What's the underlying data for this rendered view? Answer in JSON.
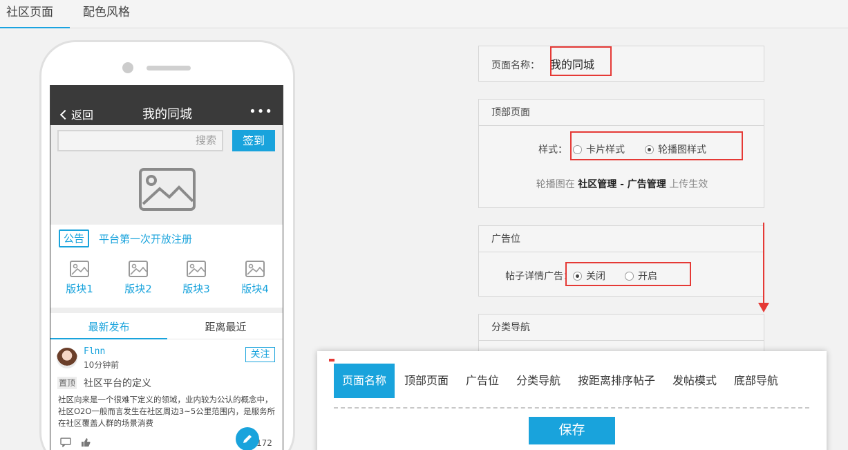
{
  "top_tabs": {
    "community_page": "社区页面",
    "color_style": "配色风格"
  },
  "phone": {
    "back_label": "返回",
    "title": "我的同城",
    "more": "•••",
    "search_placeholder": "搜索",
    "sign_in": "签到",
    "notice_tag": "公告",
    "notice_text": "平台第一次开放注册",
    "blocks": [
      "版块1",
      "版块2",
      "版块3",
      "版块4"
    ],
    "feed_tabs": [
      "最新发布",
      "距离最近"
    ],
    "post": {
      "user": "Flnn",
      "time": "10分钟前",
      "follow": "关注",
      "pin": "置顶",
      "title": "社区平台的定义",
      "body": "社区向来是一个很难下定义的领域，业内较为公认的概念中，社区O2O一般而言发生在社区周边3~5公里范围内，是服务所在社区覆盖人群的场景消费",
      "views": "172"
    }
  },
  "panels": {
    "page_name": {
      "label": "页面名称：",
      "value": "我的同城"
    },
    "top_page": {
      "title": "顶部页面",
      "style_label": "样式：",
      "options": [
        "卡片样式",
        "轮播图样式"
      ],
      "selected": "轮播图样式",
      "hint_prefix": "轮播图在",
      "hint_bold": "社区管理 - 广告管理",
      "hint_suffix": "上传生效"
    },
    "ad_slot": {
      "title": "广告位",
      "label": "帖子详情广告：",
      "options": [
        "关闭",
        "开启"
      ],
      "selected": "关闭"
    },
    "category_nav": {
      "title": "分类导航"
    }
  },
  "bottom_nav": {
    "tabs": [
      "页面名称",
      "顶部页面",
      "广告位",
      "分类导航",
      "按距离排序帖子",
      "发帖模式",
      "底部导航"
    ],
    "active": "页面名称",
    "save": "保存"
  },
  "colors": {
    "accent": "#19a3dc",
    "highlight": "#e53935"
  }
}
